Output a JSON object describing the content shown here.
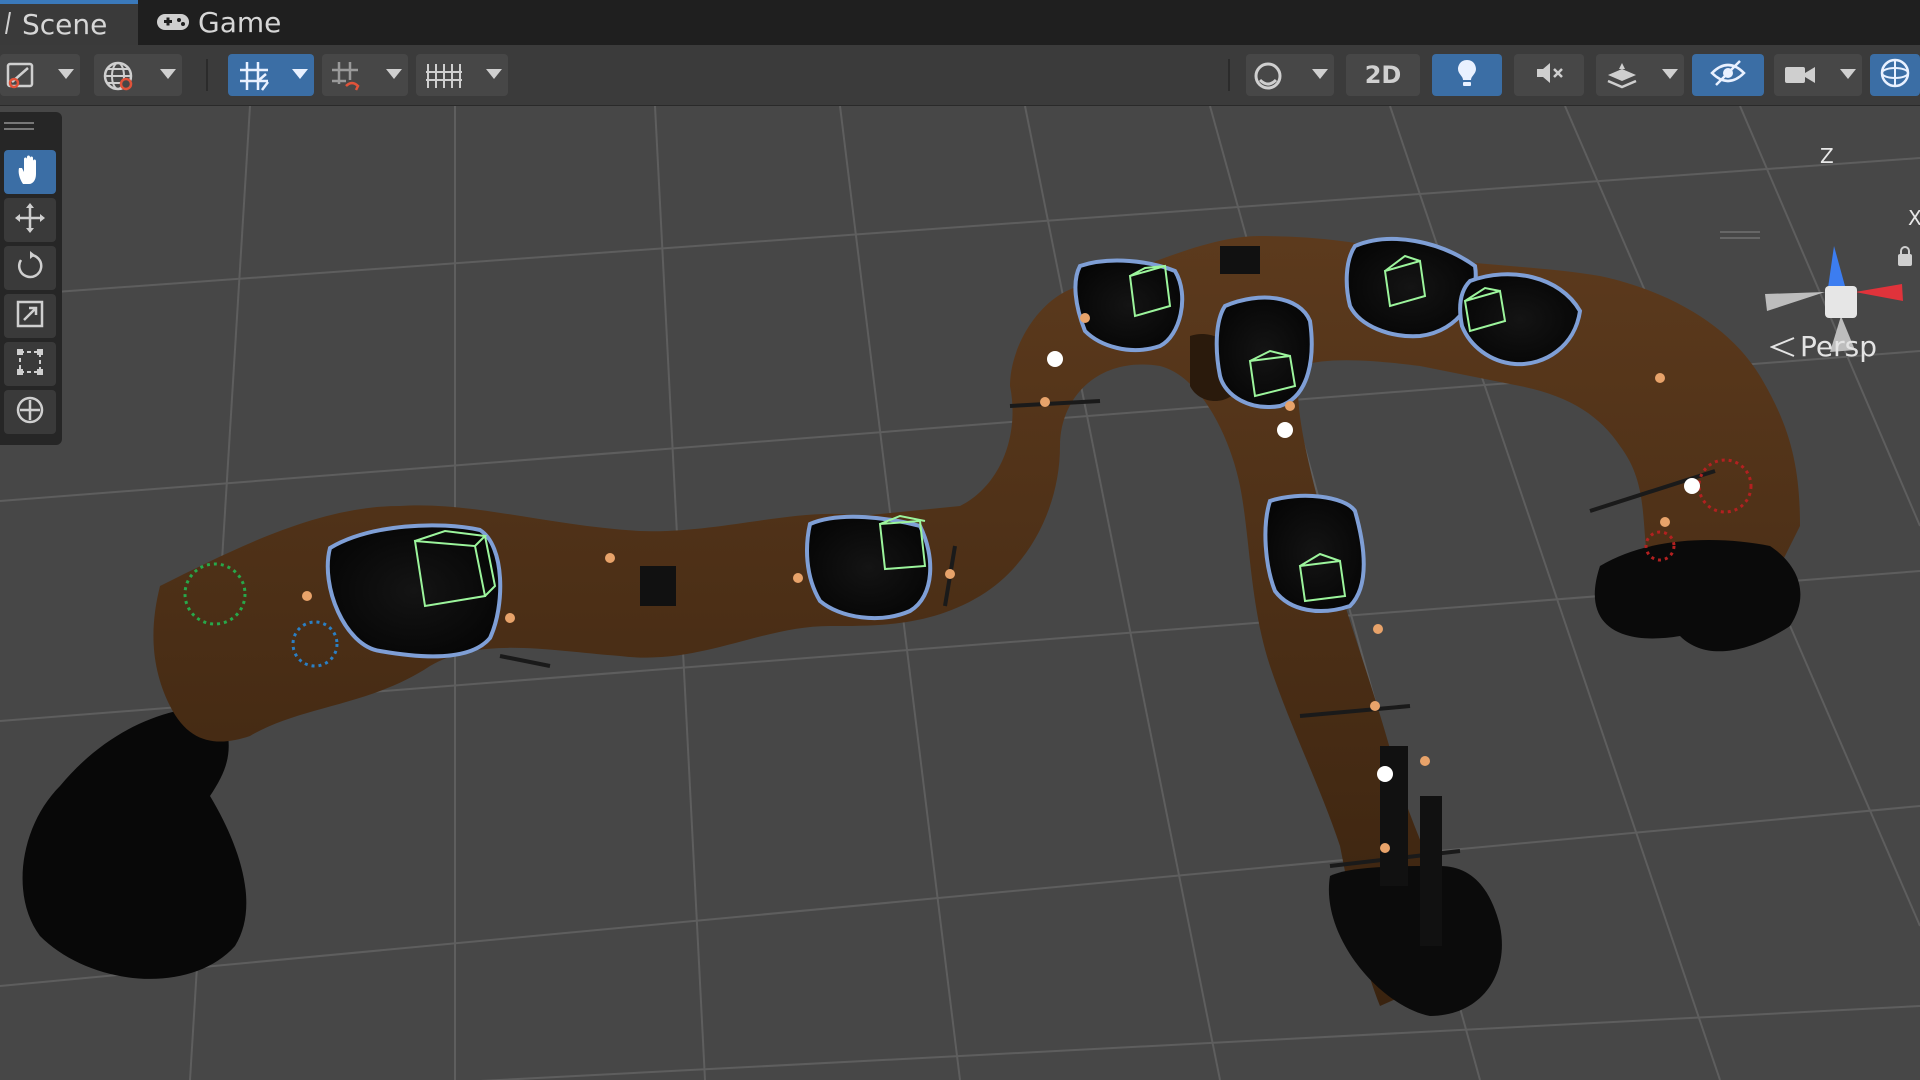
{
  "tabs": [
    {
      "label": "Scene",
      "icon": "hash-icon"
    },
    {
      "label": "Game",
      "icon": "gamepad-icon"
    }
  ],
  "toolbar": {
    "left_tools": [
      "draw-mode-icon",
      "global-icon",
      "grid-snap-icon",
      "increment-snap-icon",
      "ruler-grid-icon"
    ],
    "right_tools": [
      "shading-mode-icon",
      "2d-toggle",
      "lighting-icon",
      "audio-icon",
      "effects-icon",
      "hidden-objects-icon",
      "camera-icon",
      "gizmos-icon"
    ],
    "label_2d": "2D"
  },
  "tools": [
    "hand-tool",
    "move-tool",
    "rotate-tool",
    "scale-tool",
    "rect-tool",
    "transform-tool"
  ],
  "viewport": {
    "projection_label": "Persp",
    "gizmo": {
      "z_label": "Z",
      "x_label": "X"
    }
  },
  "colors": {
    "accent": "#3b6ea5",
    "tab_active_underline": "#3a79bb",
    "axis_x": "#e0332b",
    "axis_z": "#3c7df0",
    "selection_outline": "#7f9fd6",
    "collider_green": "#9cf59c",
    "cave_brown": "#4f3219"
  }
}
